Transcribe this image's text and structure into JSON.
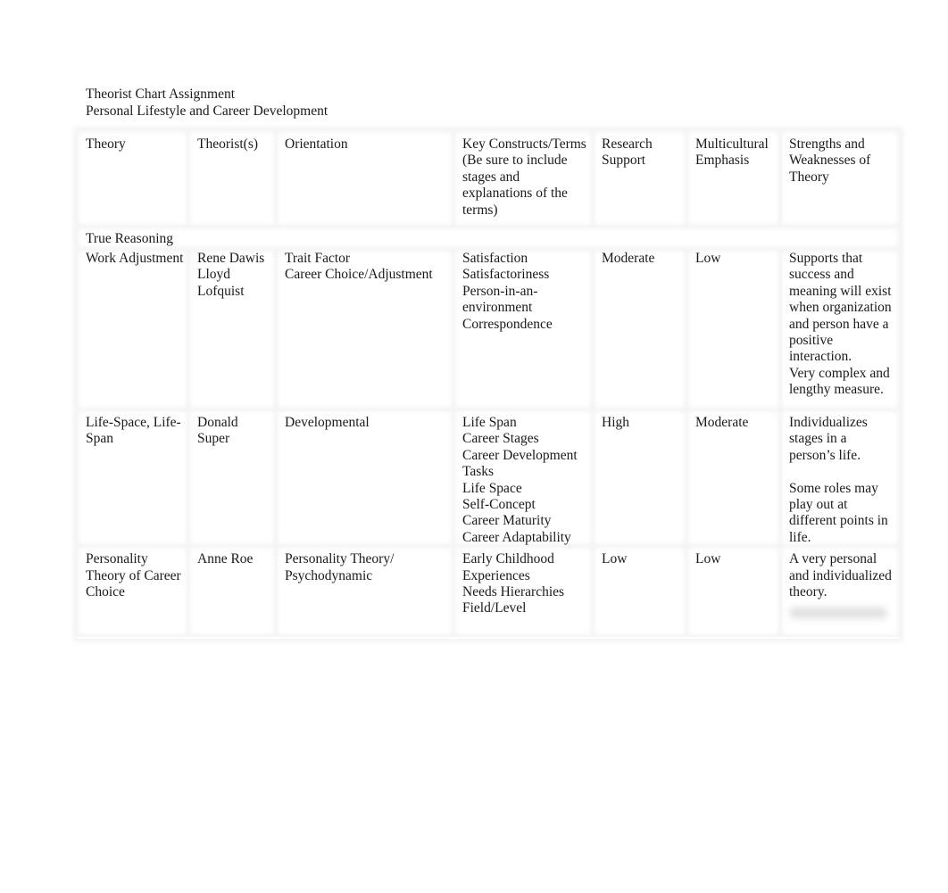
{
  "document": {
    "title": "Theorist Chart Assignment",
    "subtitle": "Personal Lifestyle and Career Development"
  },
  "table": {
    "headers": [
      "Theory",
      "Theorist(s)",
      "Orientation",
      "Key Constructs/Terms (Be sure to include stages and explanations of the terms)",
      "Research Support",
      "Multicultural Emphasis",
      "Strengths and Weaknesses of Theory"
    ],
    "section_label": "True Reasoning",
    "rows": [
      {
        "theory": "Work Adjustment",
        "theorists": "Rene Dawis\nLloyd Lofquist",
        "orientation": "Trait Factor\nCareer Choice/Adjustment",
        "key_constructs": "Satisfaction\nSatisfactoriness\nPerson-in-an-environment\nCorrespondence",
        "research_support": "Moderate",
        "multicultural_emphasis": "Low",
        "strengths_weaknesses": "Supports that success and meaning will exist when organization and person have a positive interaction.\nVery complex and lengthy measure."
      },
      {
        "theory": "Life-Space, Life-Span",
        "theorists": "Donald Super",
        "orientation": "Developmental",
        "key_constructs": "Life Span\nCareer Stages\nCareer Development Tasks\nLife Space\nSelf-Concept\nCareer Maturity\nCareer Adaptability",
        "research_support": "High",
        "multicultural_emphasis": "Moderate",
        "strengths_weaknesses": "Individualizes stages in a person’s life.\n\nSome roles may play out at different points in life."
      },
      {
        "theory": "Personality Theory of Career Choice",
        "theorists": "Anne Roe",
        "orientation": "Personality Theory/\nPsychodynamic",
        "key_constructs": "Early Childhood Experiences\nNeeds Hierarchies\nField/Level",
        "research_support": "Low",
        "multicultural_emphasis": "Low",
        "strengths_weaknesses": "A very personal and individualized theory."
      }
    ]
  }
}
